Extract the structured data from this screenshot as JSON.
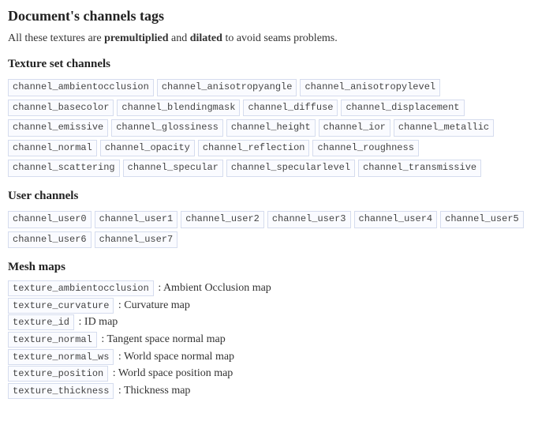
{
  "title": "Document's channels tags",
  "intro_parts": {
    "p1": "All these textures are ",
    "b1": "premultiplied",
    "p2": " and ",
    "b2": "dilated",
    "p3": " to avoid seams problems."
  },
  "sections": {
    "texture_set": {
      "heading": "Texture set channels",
      "tags": [
        "channel_ambientocclusion",
        "channel_anisotropyangle",
        "channel_anisotropylevel",
        "channel_basecolor",
        "channel_blendingmask",
        "channel_diffuse",
        "channel_displacement",
        "channel_emissive",
        "channel_glossiness",
        "channel_height",
        "channel_ior",
        "channel_metallic",
        "channel_normal",
        "channel_opacity",
        "channel_reflection",
        "channel_roughness",
        "channel_scattering",
        "channel_specular",
        "channel_specularlevel",
        "channel_transmissive"
      ]
    },
    "user_channels": {
      "heading": "User channels",
      "tags": [
        "channel_user0",
        "channel_user1",
        "channel_user2",
        "channel_user3",
        "channel_user4",
        "channel_user5",
        "channel_user6",
        "channel_user7"
      ]
    },
    "mesh_maps": {
      "heading": "Mesh maps",
      "items": [
        {
          "tag": "texture_ambientocclusion",
          "desc": "Ambient Occlusion map"
        },
        {
          "tag": "texture_curvature",
          "desc": "Curvature map"
        },
        {
          "tag": "texture_id",
          "desc": "ID map"
        },
        {
          "tag": "texture_normal",
          "desc": "Tangent space normal map"
        },
        {
          "tag": "texture_normal_ws",
          "desc": "World space normal map"
        },
        {
          "tag": "texture_position",
          "desc": "World space position map"
        },
        {
          "tag": "texture_thickness",
          "desc": "Thickness map"
        }
      ]
    }
  }
}
